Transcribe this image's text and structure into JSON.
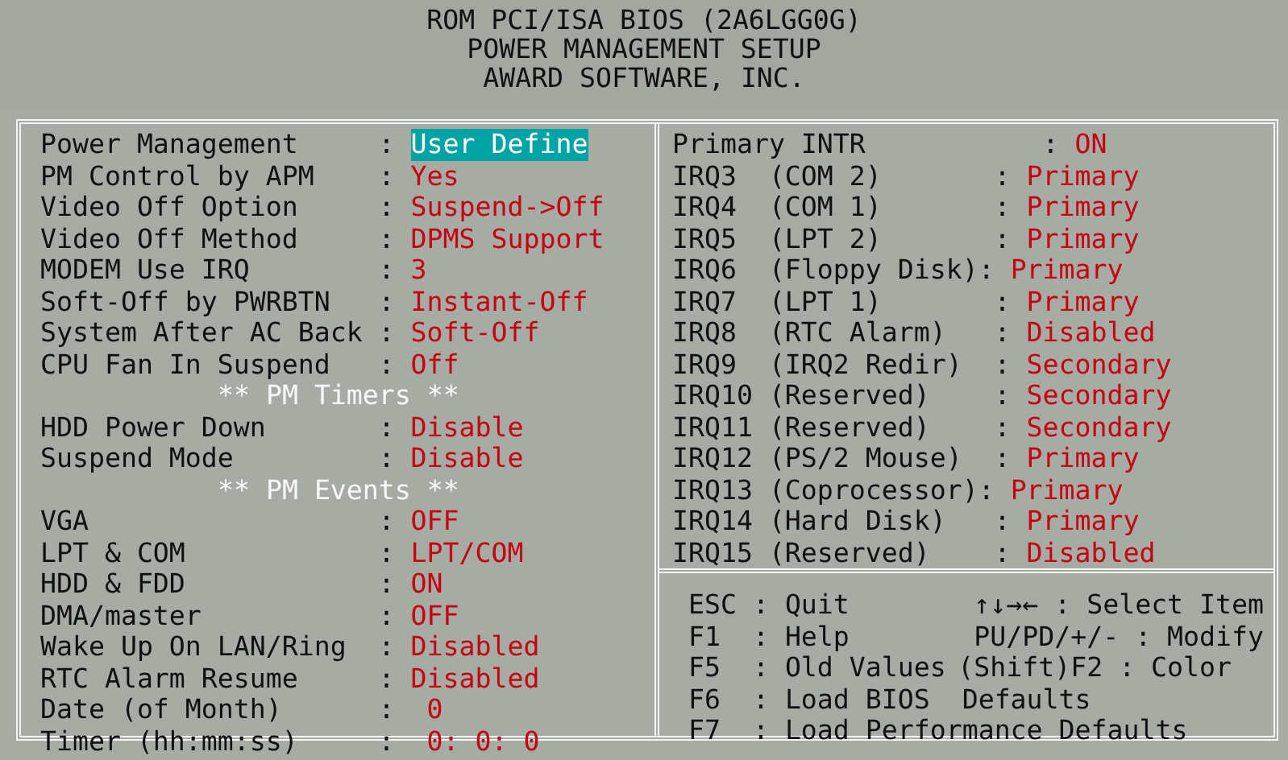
{
  "header": {
    "lines": [
      "ROM PCI/ISA BIOS (2A6LGG0G)",
      "POWER MANAGEMENT SETUP",
      "AWARD SOFTWARE, INC."
    ]
  },
  "left_settings": [
    {
      "kind": "setting",
      "label": "Power Management     :",
      "value": "User Define",
      "selected": true
    },
    {
      "kind": "setting",
      "label": "PM Control by APM    :",
      "value": "Yes",
      "selected": false
    },
    {
      "kind": "setting",
      "label": "Video Off Option     :",
      "value": "Suspend->Off",
      "selected": false
    },
    {
      "kind": "setting",
      "label": "Video Off Method     :",
      "value": "DPMS Support",
      "selected": false
    },
    {
      "kind": "setting",
      "label": "MODEM Use IRQ        :",
      "value": "3",
      "selected": false
    },
    {
      "kind": "setting",
      "label": "Soft-Off by PWRBTN   :",
      "value": "Instant-Off",
      "selected": false
    },
    {
      "kind": "setting",
      "label": "System After AC Back :",
      "value": "Soft-Off",
      "selected": false
    },
    {
      "kind": "setting",
      "label": "CPU Fan In Suspend   :",
      "value": "Off",
      "selected": false
    },
    {
      "kind": "heading",
      "label": "** PM Timers **"
    },
    {
      "kind": "setting",
      "label": "HDD Power Down       :",
      "value": "Disable",
      "selected": false
    },
    {
      "kind": "setting",
      "label": "Suspend Mode         :",
      "value": "Disable",
      "selected": false
    },
    {
      "kind": "heading",
      "label": "** PM Events **"
    },
    {
      "kind": "setting",
      "label": "VGA                  :",
      "value": "OFF",
      "selected": false
    },
    {
      "kind": "setting",
      "label": "LPT & COM            :",
      "value": "LPT/COM",
      "selected": false
    },
    {
      "kind": "setting",
      "label": "HDD & FDD            :",
      "value": "ON",
      "selected": false
    },
    {
      "kind": "setting",
      "label": "DMA/master           :",
      "value": "OFF",
      "selected": false
    },
    {
      "kind": "setting",
      "label": "Wake Up On LAN/Ring  :",
      "value": "Disabled",
      "selected": false
    },
    {
      "kind": "setting",
      "label": "RTC Alarm Resume     :",
      "value": "Disabled",
      "selected": false
    },
    {
      "kind": "setting",
      "label": "Date (of Month)      :",
      "value": " 0",
      "selected": false
    },
    {
      "kind": "setting",
      "label": "Timer (hh:mm:ss)     :",
      "value": " 0: 0: 0",
      "selected": false
    }
  ],
  "right_settings": [
    {
      "kind": "setting",
      "label": "Primary INTR           :",
      "value": "ON",
      "selected": false
    },
    {
      "kind": "setting",
      "label": "IRQ3  (COM 2)       :",
      "value": "Primary",
      "selected": false
    },
    {
      "kind": "setting",
      "label": "IRQ4  (COM 1)       :",
      "value": "Primary",
      "selected": false
    },
    {
      "kind": "setting",
      "label": "IRQ5  (LPT 2)       :",
      "value": "Primary",
      "selected": false
    },
    {
      "kind": "setting",
      "label": "IRQ6  (Floppy Disk):",
      "value": "Primary",
      "selected": false
    },
    {
      "kind": "setting",
      "label": "IRQ7  (LPT 1)       :",
      "value": "Primary",
      "selected": false
    },
    {
      "kind": "setting",
      "label": "IRQ8  (RTC Alarm)   :",
      "value": "Disabled",
      "selected": false
    },
    {
      "kind": "setting",
      "label": "IRQ9  (IRQ2 Redir)  :",
      "value": "Secondary",
      "selected": false
    },
    {
      "kind": "setting",
      "label": "IRQ10 (Reserved)    :",
      "value": "Secondary",
      "selected": false
    },
    {
      "kind": "setting",
      "label": "IRQ11 (Reserved)    :",
      "value": "Secondary",
      "selected": false
    },
    {
      "kind": "setting",
      "label": "IRQ12 (PS/2 Mouse)  :",
      "value": "Primary",
      "selected": false
    },
    {
      "kind": "setting",
      "label": "IRQ13 (Coprocessor):",
      "value": "Primary",
      "selected": false
    },
    {
      "kind": "setting",
      "label": "IRQ14 (Hard Disk)   :",
      "value": "Primary",
      "selected": false
    },
    {
      "kind": "setting",
      "label": "IRQ15 (Reserved)    :",
      "value": "Disabled",
      "selected": false
    }
  ],
  "help": [
    {
      "left": "ESC : Quit",
      "right": "↑↓→← : Select Item"
    },
    {
      "left": "F1  : Help",
      "right": "PU/PD/+/- : Modify"
    },
    {
      "left": "F5  : Old Values",
      "right": "(Shift)F2 : Color  "
    },
    {
      "left": "F6  : Load BIOS  Defaults"
    },
    {
      "left": "F7  : Load Performance Defaults"
    }
  ]
}
